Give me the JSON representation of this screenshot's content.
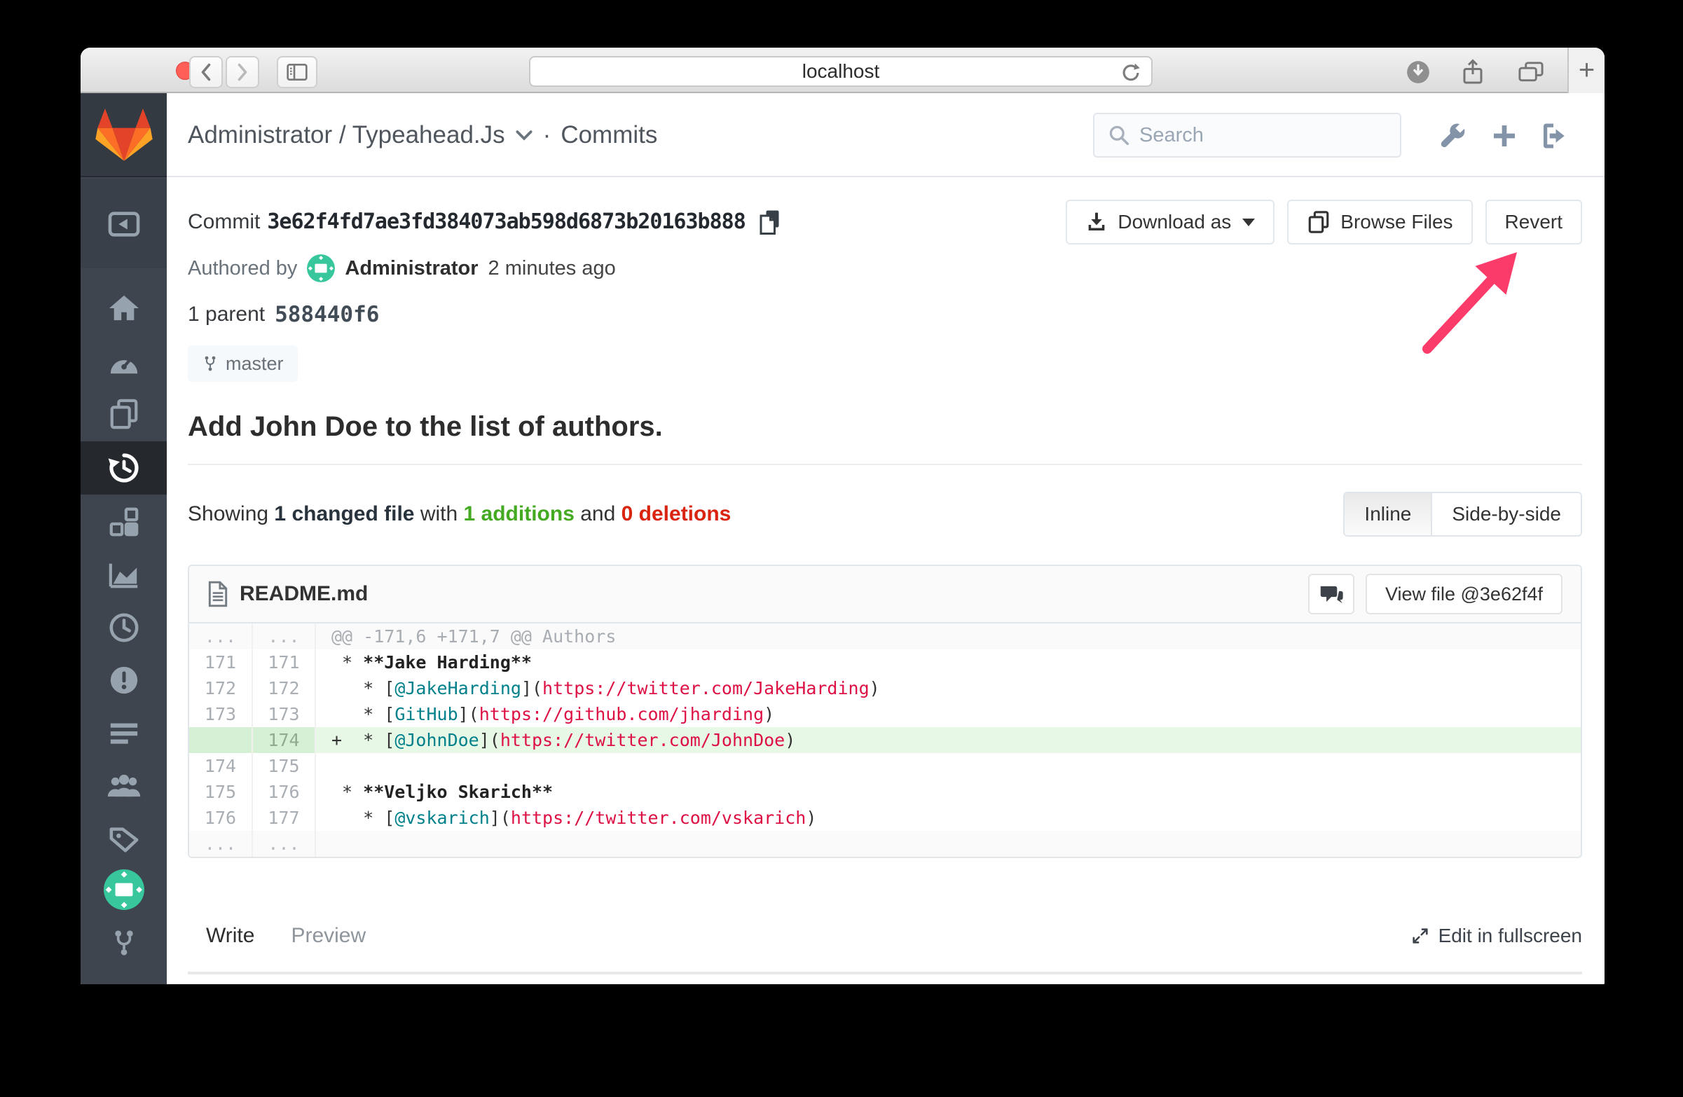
{
  "browser": {
    "url": "localhost",
    "new_tab_glyph": "+",
    "icons": [
      "close",
      "minimize",
      "zoom",
      "back-icon",
      "forward-icon",
      "sidebar-toggle-icon",
      "reload-icon",
      "downloads-icon",
      "share-icon",
      "tabs-icon",
      "new-tab-icon"
    ]
  },
  "sidebar": {
    "icons": [
      "gitlab-logo",
      "collapse-icon",
      "home-icon",
      "activity-icon",
      "files-icon",
      "commits-icon",
      "network-icon",
      "graphs-icon",
      "builds-icon",
      "issues-icon",
      "merge-requests-icon",
      "members-icon",
      "labels-icon",
      "user-avatar",
      "fork-icon"
    ],
    "active": "commits-icon"
  },
  "header": {
    "project_path": "Administrator / Typeahead.Js",
    "separator": "·",
    "section": "Commits",
    "search_placeholder": "Search",
    "icons": [
      "wrench-icon",
      "plus-icon",
      "sign-out-icon"
    ]
  },
  "commit": {
    "label": "Commit",
    "sha": "3e62f4fd7ae3fd384073ab598d6873b20163b888",
    "authored_by": "Authored by",
    "author": "Administrator",
    "time_ago": "2 minutes ago",
    "parents_label": "1 parent",
    "parent_sha": "588440f6",
    "branch": "master",
    "message": "Add John Doe to the list of authors."
  },
  "actions": {
    "download_as": "Download as",
    "browse_files": "Browse Files",
    "revert": "Revert"
  },
  "summary": {
    "showing": "Showing",
    "changed_file": "1 changed file",
    "with": "with",
    "additions": "1 additions",
    "and": "and",
    "deletions": "0 deletions"
  },
  "view_toggle": {
    "inline": "Inline",
    "side_by_side": "Side-by-side"
  },
  "diff": {
    "file_name": "README.md",
    "view_file": "View file @3e62f4f",
    "rows": [
      {
        "type": "match",
        "old": "...",
        "new": "...",
        "segs": [
          [
            "@@ -171,6 +171,7 @@ Authors",
            "meta"
          ]
        ]
      },
      {
        "type": "ctx",
        "old": "171",
        "new": "171",
        "segs": [
          [
            " * ",
            "p"
          ],
          [
            "**Jake Harding**",
            "b"
          ]
        ]
      },
      {
        "type": "ctx",
        "old": "172",
        "new": "172",
        "segs": [
          [
            "   * [",
            "p"
          ],
          [
            "@JakeHarding",
            "t"
          ],
          [
            "](",
            "p"
          ],
          [
            "https://twitter.com/JakeHarding",
            "u"
          ],
          [
            ")",
            "p"
          ]
        ]
      },
      {
        "type": "ctx",
        "old": "173",
        "new": "173",
        "segs": [
          [
            "   * [",
            "p"
          ],
          [
            "GitHub",
            "t"
          ],
          [
            "](",
            "p"
          ],
          [
            "https://github.com/jharding",
            "u"
          ],
          [
            ")",
            "p"
          ]
        ]
      },
      {
        "type": "add",
        "old": "",
        "new": "174",
        "segs": [
          [
            "+  * [",
            "p"
          ],
          [
            "@JohnDoe",
            "t"
          ],
          [
            "](",
            "p"
          ],
          [
            "https://twitter.com/JohnDoe",
            "u"
          ],
          [
            ")",
            "p"
          ]
        ]
      },
      {
        "type": "ctx",
        "old": "174",
        "new": "175",
        "segs": []
      },
      {
        "type": "ctx",
        "old": "175",
        "new": "176",
        "segs": [
          [
            " * ",
            "p"
          ],
          [
            "**Veljko Skarich**",
            "b"
          ]
        ]
      },
      {
        "type": "ctx",
        "old": "176",
        "new": "177",
        "segs": [
          [
            "   * [",
            "p"
          ],
          [
            "@vskarich",
            "t"
          ],
          [
            "](",
            "p"
          ],
          [
            "https://twitter.com/vskarich",
            "u"
          ],
          [
            ")",
            "p"
          ]
        ]
      },
      {
        "type": "match",
        "old": "...",
        "new": "...",
        "segs": []
      }
    ]
  },
  "editor": {
    "write_tab": "Write",
    "preview_tab": "Preview",
    "fullscreen": "Edit in fullscreen"
  },
  "colors": {
    "accent_blue": "#4584df",
    "additions_green": "#44aa22",
    "deletions_red": "#d9240f",
    "link_teal": "#00808a",
    "url_crimson": "#dd1144",
    "added_line_bg": "#e7f8e7",
    "annotation_arrow_pink": "#fb3b69",
    "avatar_green": "#38c79d",
    "sidebar_bg": "#3e454e",
    "gitlab_orange": "#fc6d26"
  }
}
